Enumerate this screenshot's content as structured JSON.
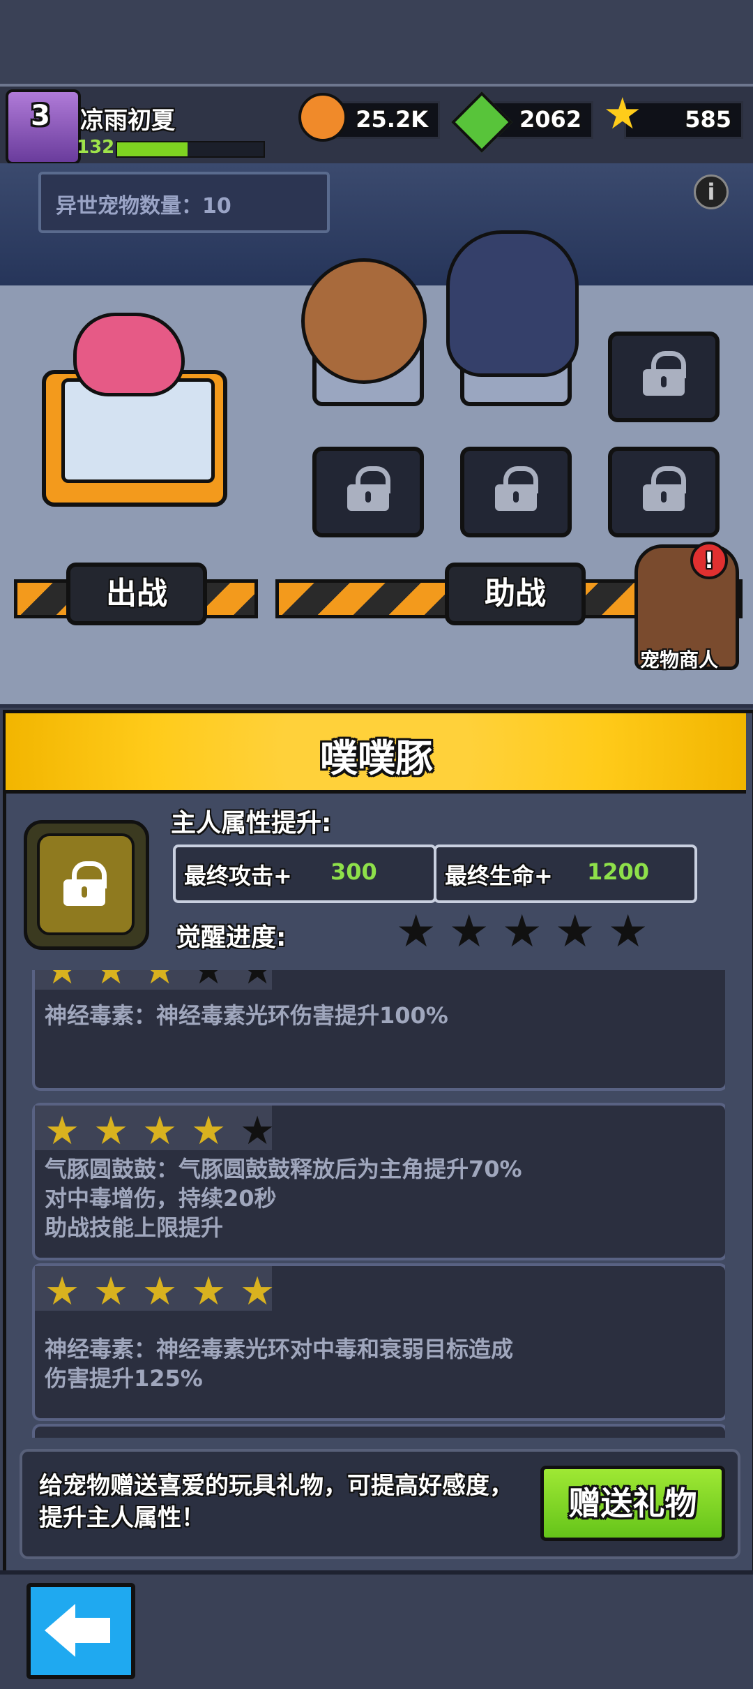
{
  "player": {
    "badge_level": "3",
    "name": "凉雨初夏",
    "level": "132",
    "xp_fraction": 0.48
  },
  "resources": {
    "coins": "25.2K",
    "gems": "2062",
    "stars": "585"
  },
  "stage": {
    "pet_count_label": "异世宠物数量：10",
    "battle_button": "出战",
    "assist_button": "助战",
    "merchant_label": "宠物商人",
    "info_icon": "i",
    "merchant_alert": "!"
  },
  "pet": {
    "name": "噗噗豚",
    "owner_bonus_title": "主人属性提升:",
    "attack_label": "最终攻击+",
    "attack_value": "300",
    "hp_label": "最终生命+",
    "hp_value": "1200",
    "awaken_label": "觉醒进度:",
    "awaken_stars_filled": 0,
    "awaken_stars_total": 5
  },
  "skills": [
    {
      "stars": 3,
      "text": "神经毒素：神经毒素光环伤害提升100%"
    },
    {
      "stars": 4,
      "text": "气豚圆鼓鼓：气豚圆鼓鼓释放后为主角提升70%\n对中毒增伤，持续20秒\n助战技能上限提升"
    },
    {
      "stars": 5,
      "text": "神经毒素：神经毒素光环对中毒和衰弱目标造成\n伤害提升125%"
    }
  ],
  "footer": {
    "hint": "给宠物赠送喜爱的玩具礼物，可提高好感度，\n提升主人属性！",
    "gift_button": "赠送礼物"
  },
  "colors": {
    "accent_yellow": "#ffcb1a",
    "gift_green": "#7ed321",
    "back_blue": "#1fa9f0",
    "bonus_value_green": "#8ee04a"
  }
}
